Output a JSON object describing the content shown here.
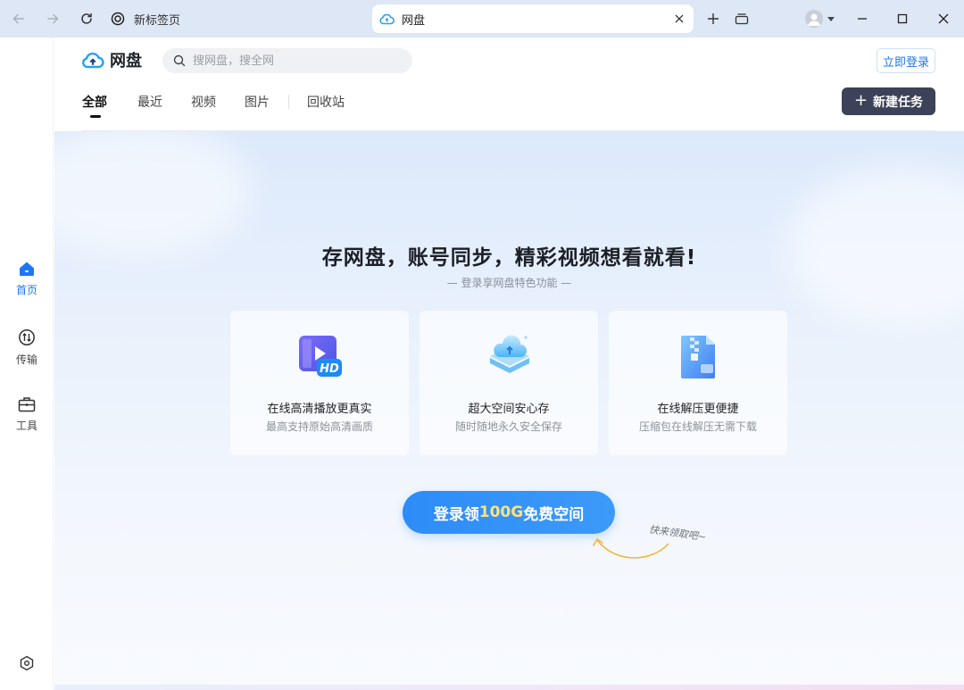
{
  "browser": {
    "new_tab_label": "新标签页",
    "active_tab_label": "网盘"
  },
  "sidebar": {
    "items": [
      {
        "label": "首页",
        "icon": "home-icon",
        "active": true
      },
      {
        "label": "传输",
        "icon": "transfer-icon",
        "active": false
      },
      {
        "label": "工具",
        "icon": "toolbox-icon",
        "active": false
      }
    ],
    "settings_icon": "settings-icon"
  },
  "header": {
    "logo_text": "网盘",
    "search_placeholder": "搜网盘，搜全网",
    "login_label": "立即登录",
    "new_task_label": "新建任务"
  },
  "tabs": [
    {
      "label": "全部",
      "active": true
    },
    {
      "label": "最近",
      "active": false
    },
    {
      "label": "视频",
      "active": false
    },
    {
      "label": "图片",
      "active": false
    },
    {
      "label": "回收站",
      "active": false
    }
  ],
  "hero": {
    "title": "存网盘，账号同步，精彩视频想看就看!",
    "subtitle": "— 登录享网盘特色功能 —",
    "features": [
      {
        "title": "在线高清播放更真实",
        "desc": "最高支持原始高清画质",
        "icon": "hd-video-icon"
      },
      {
        "title": "超大空间安心存",
        "desc": "随时随地永久安全保存",
        "icon": "cloud-storage-icon"
      },
      {
        "title": "在线解压更便捷",
        "desc": "压缩包在线解压无需下载",
        "icon": "zip-file-icon"
      }
    ],
    "cta_prefix": "登录领",
    "cta_highlight": "100G",
    "cta_suffix": "免费空间",
    "hint": "快来领取吧~"
  },
  "colors": {
    "accent": "#1d77f2",
    "cta": "#2d8cf7",
    "new_task_bg": "#3c4257",
    "highlight": "#ffe27a"
  }
}
